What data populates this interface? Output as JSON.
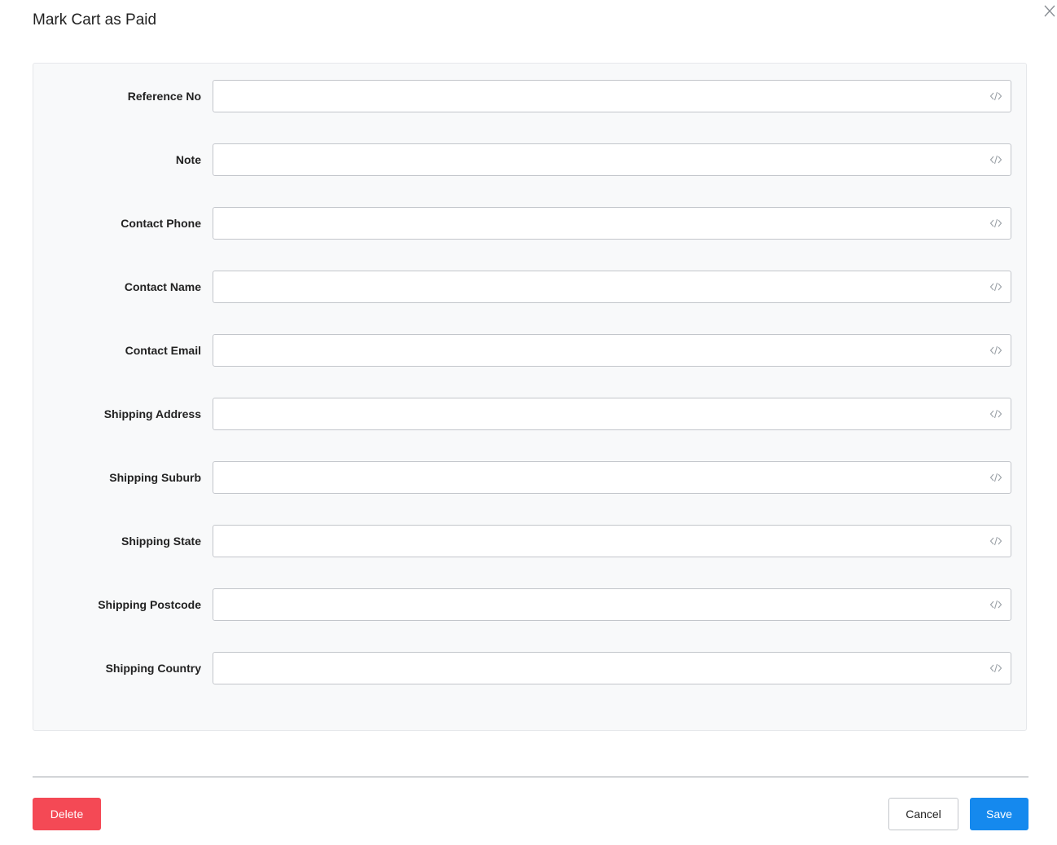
{
  "dialog": {
    "title": "Mark Cart as Paid",
    "close_icon": "close-icon"
  },
  "form": {
    "fields": [
      {
        "label": "Reference No",
        "value": "",
        "icon": "code-icon"
      },
      {
        "label": "Note",
        "value": "",
        "icon": "code-icon"
      },
      {
        "label": "Contact Phone",
        "value": "",
        "icon": "code-icon"
      },
      {
        "label": "Contact Name",
        "value": "",
        "icon": "code-icon"
      },
      {
        "label": "Contact Email",
        "value": "",
        "icon": "code-icon"
      },
      {
        "label": "Shipping Address",
        "value": "",
        "icon": "code-icon"
      },
      {
        "label": "Shipping Suburb",
        "value": "",
        "icon": "code-icon"
      },
      {
        "label": "Shipping State",
        "value": "",
        "icon": "code-icon"
      },
      {
        "label": "Shipping Postcode",
        "value": "",
        "icon": "code-icon"
      },
      {
        "label": "Shipping Country",
        "value": "",
        "icon": "code-icon"
      }
    ]
  },
  "footer": {
    "delete_label": "Delete",
    "cancel_label": "Cancel",
    "save_label": "Save"
  },
  "colors": {
    "delete": "#f44955",
    "save": "#1589ee",
    "panel_background": "#f8f9fa"
  }
}
